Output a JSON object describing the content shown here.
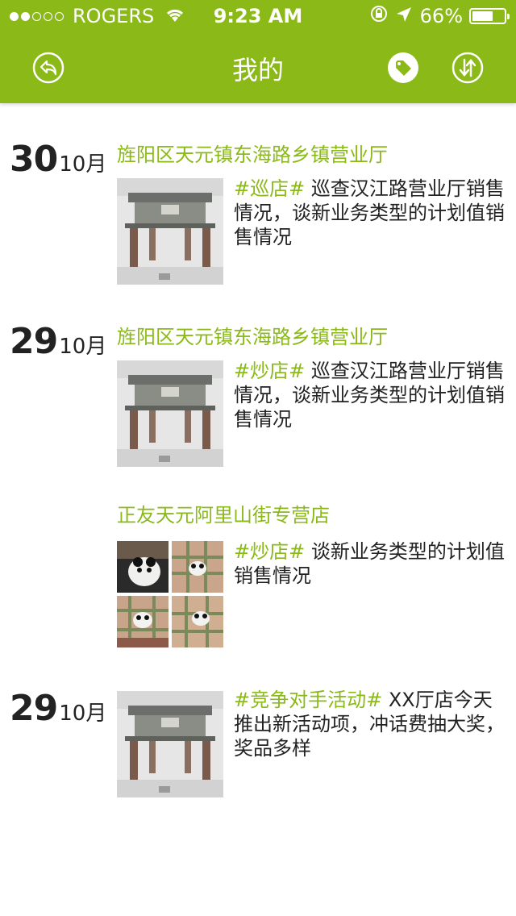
{
  "status_bar": {
    "carrier": "ROGERS",
    "time": "9:23 AM",
    "battery": "66%",
    "battery_level": 0.66,
    "signal_bars_filled": 2,
    "signal_bars_total": 5
  },
  "nav": {
    "title": "我的",
    "back_icon": "back-reply-icon",
    "tag_icon": "tag-icon",
    "sort_icon": "sort-swap-icon"
  },
  "colors": {
    "accent": "#8ab918",
    "text": "#222222"
  },
  "feed": [
    {
      "day": "30",
      "month": "10月",
      "location": "旌阳区天元镇东海路乡镇营业厅",
      "tag": "#巡店#",
      "text": " 巡查汉江路营业厅销售情况，谈新业务类型的计划值销售情况",
      "image": "snowy-archway-photo"
    },
    {
      "day": "29",
      "month": "10月",
      "location": "旌阳区天元镇东海路乡镇营业厅",
      "tag": "#炒店#",
      "text": " 巡查汉江路营业厅销售情况，谈新业务类型的计划值销售情况",
      "image": "snowy-archway-photo"
    },
    {
      "day": "",
      "month": "",
      "location": "正友天元阿里山街专营店",
      "tag": "#炒店#",
      "text": " 谈新业务类型的计划值销售情况",
      "images": [
        "panda-toy-photo-1",
        "panda-toy-photo-2",
        "panda-toy-photo-3",
        "panda-toy-photo-4"
      ]
    },
    {
      "day": "29",
      "month": "10月",
      "location": "",
      "tag": "#竞争对手活动#",
      "text": " XX厅店今天推出新活动项，冲话费抽大奖，奖品多样",
      "image": "snowy-archway-photo"
    }
  ]
}
